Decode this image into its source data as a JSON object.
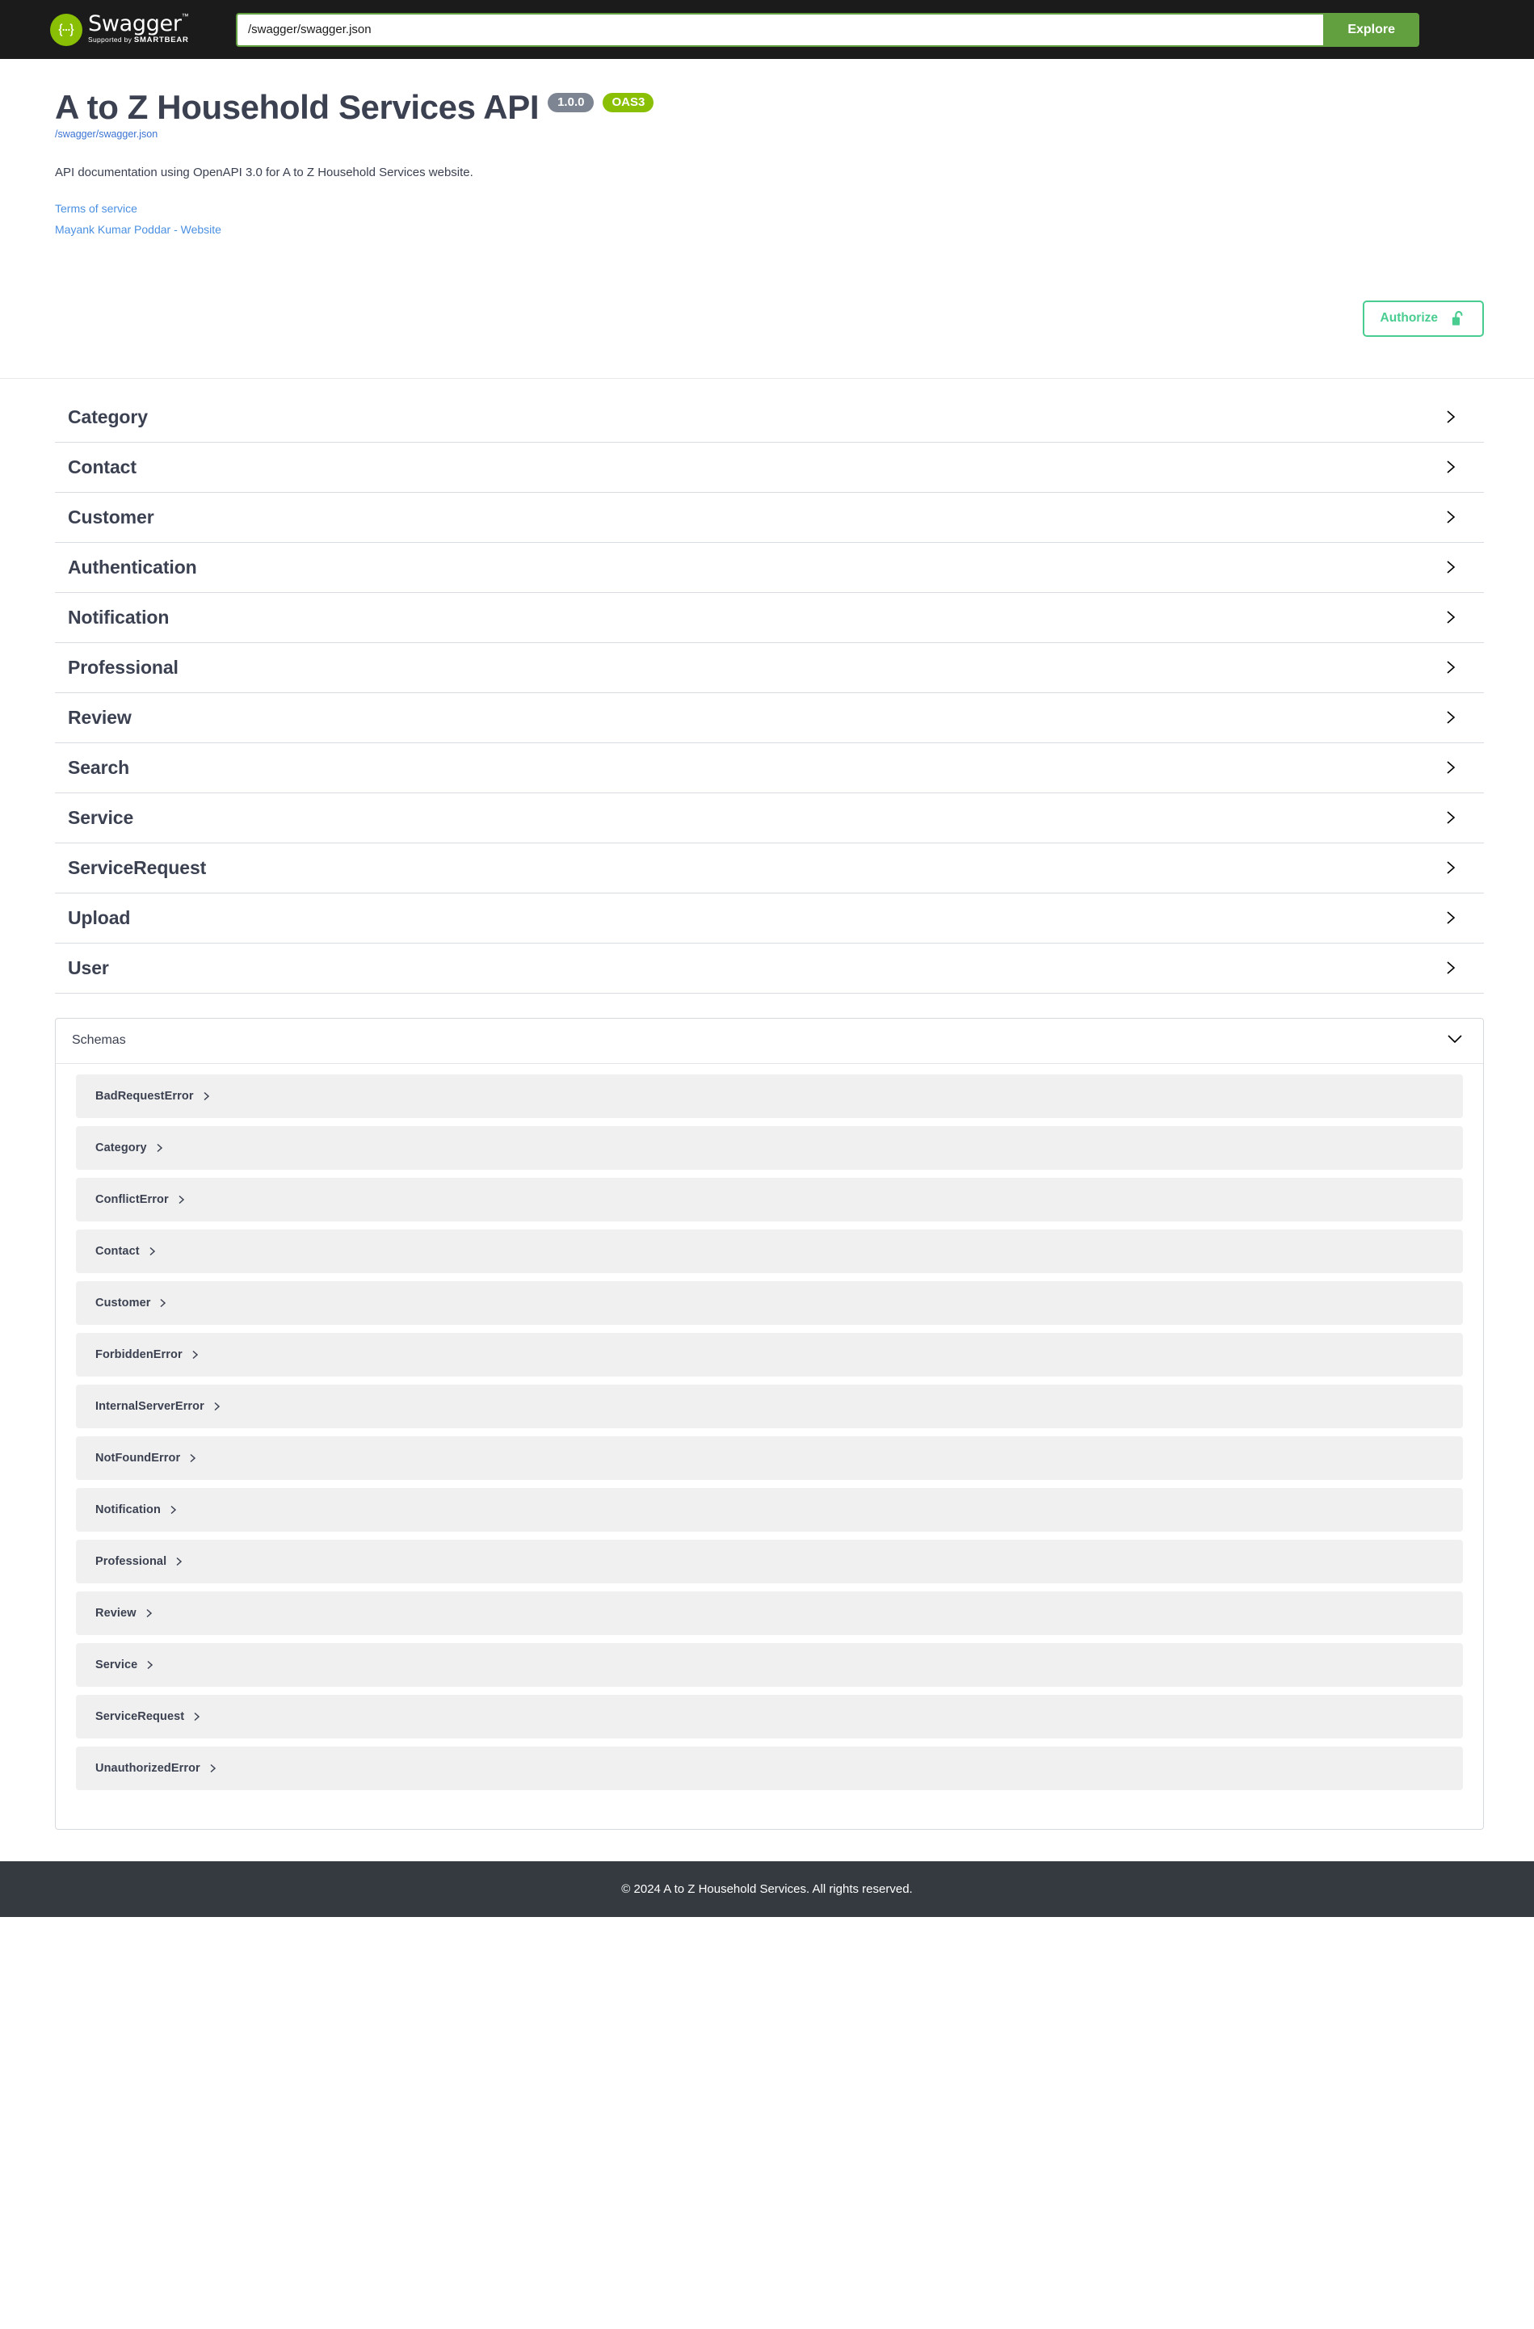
{
  "topbar": {
    "logo_word": "Swagger",
    "logo_tm": "™",
    "logo_supported_prefix": "Supported by ",
    "logo_supported_brand": "SMARTBEAR",
    "logo_icon": "swagger-braces-icon",
    "url_value": "/swagger/swagger.json",
    "url_placeholder": "/swagger/swagger.json",
    "explore_label": "Explore"
  },
  "info": {
    "title": "A to Z Household Services API",
    "version_badge": "1.0.0",
    "oas_badge": "OAS3",
    "spec_url": "/swagger/swagger.json",
    "description": "API documentation using OpenAPI 3.0 for A to Z Household Services website.",
    "terms_link": "Terms of service",
    "contact_link": "Mayank Kumar Poddar - Website"
  },
  "authorize": {
    "label": "Authorize",
    "icon": "unlock-icon"
  },
  "tags": [
    {
      "name": "Category"
    },
    {
      "name": "Contact"
    },
    {
      "name": "Customer"
    },
    {
      "name": "Authentication"
    },
    {
      "name": "Notification"
    },
    {
      "name": "Professional"
    },
    {
      "name": "Review"
    },
    {
      "name": "Search"
    },
    {
      "name": "Service"
    },
    {
      "name": "ServiceRequest"
    },
    {
      "name": "Upload"
    },
    {
      "name": "User"
    }
  ],
  "schemas": {
    "header": "Schemas",
    "expanded": true,
    "models": [
      {
        "name": "BadRequestError"
      },
      {
        "name": "Category"
      },
      {
        "name": "ConflictError"
      },
      {
        "name": "Contact"
      },
      {
        "name": "Customer"
      },
      {
        "name": "ForbiddenError"
      },
      {
        "name": "InternalServerError"
      },
      {
        "name": "NotFoundError"
      },
      {
        "name": "Notification"
      },
      {
        "name": "Professional"
      },
      {
        "name": "Review"
      },
      {
        "name": "Service"
      },
      {
        "name": "ServiceRequest"
      },
      {
        "name": "UnauthorizedError"
      }
    ]
  },
  "footer": {
    "text": "© 2024 A to Z Household Services. All rights reserved."
  },
  "colors": {
    "swagger_green": "#89bf04",
    "explore_green": "#62a03f",
    "authorize_green": "#49cc90",
    "title_navy": "#3b4151",
    "link_blue": "#4a90e2",
    "footer_dark": "#343a40",
    "model_row_bg": "#f0f0f0"
  }
}
